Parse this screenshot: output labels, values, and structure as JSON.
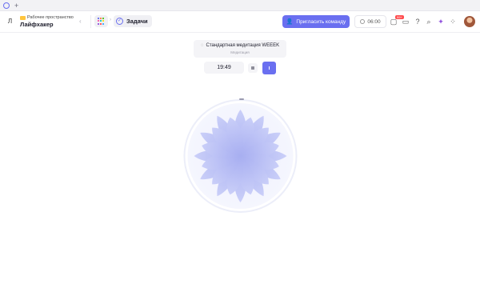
{
  "browser": {
    "new_tab_label": "+"
  },
  "workspace": {
    "avatar_letter": "Л",
    "subtitle": "Рабочее пространство",
    "name": "Лайфхакер"
  },
  "breadcrumb": {
    "current": "Задачи"
  },
  "header": {
    "invite_label": "Пригласить команду",
    "timer_value": "06:00",
    "notifications_badge": "99+",
    "accent_color": "#6a6ff0"
  },
  "meditation": {
    "title": "Стандартная медитация WEEEK",
    "subtitle": "Медитация",
    "time": "19:49"
  },
  "icons": {
    "apps": "apps-grid-icon",
    "tasks": "tasks-check-icon",
    "invite": "add-user-icon",
    "timer": "timer-icon",
    "chat": "chat-icon",
    "folder": "folder-icon",
    "help": "help-icon",
    "search": "search-icon",
    "ai": "sparkle-icon",
    "more": "grid-dots-icon"
  }
}
